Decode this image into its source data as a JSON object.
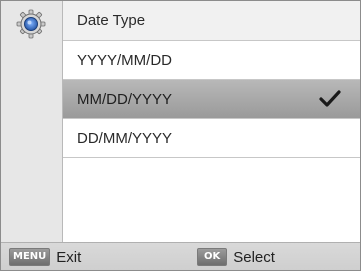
{
  "menu": {
    "title": "Date Type",
    "title_icon": "gear-icon",
    "options": [
      {
        "label": "YYYY/MM/DD",
        "selected": false
      },
      {
        "label": "MM/DD/YYYY",
        "selected": true
      },
      {
        "label": "DD/MM/YYYY",
        "selected": false
      }
    ],
    "selected_mark": "checkmark-icon"
  },
  "footer": {
    "menu_key": "MENU",
    "menu_action": "Exit",
    "ok_key": "OK",
    "ok_action": "Select"
  },
  "colors": {
    "selected_row": "#a8a8a8",
    "accent_blue": "#2a6fd0"
  }
}
